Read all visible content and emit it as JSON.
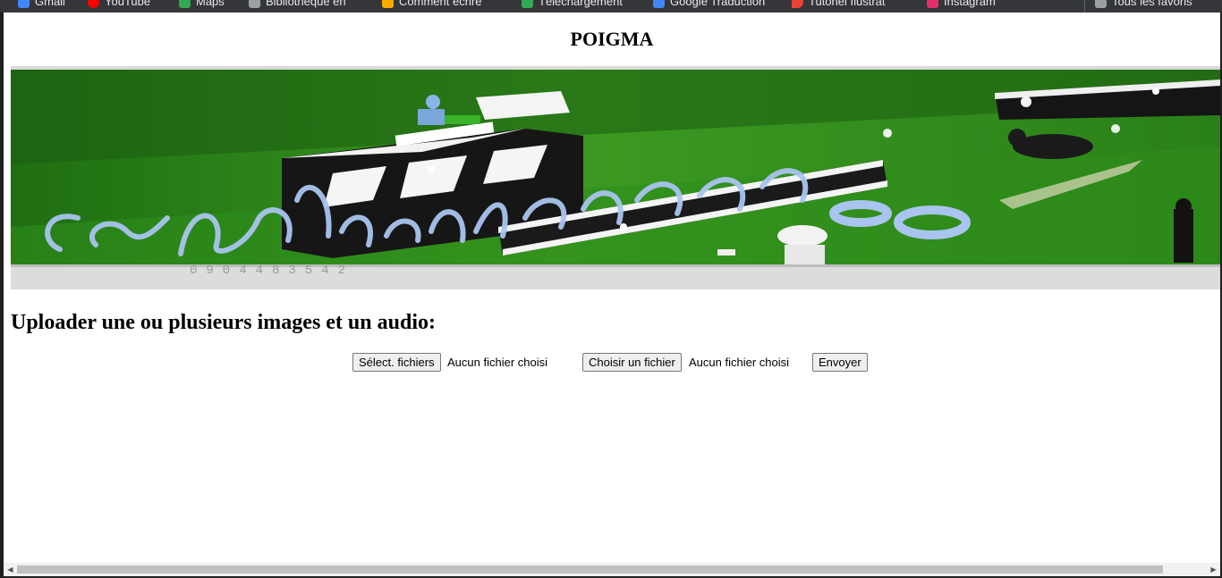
{
  "page": {
    "title": "POIGMA",
    "upload_heading": "Uploader une ou plusieurs images et un audio:"
  },
  "bookmarks": [
    {
      "label": "Gmail",
      "icon": "gmail-icon",
      "color": "#4285f4"
    },
    {
      "label": "YouTube",
      "icon": "youtube-icon",
      "color": "#ff0000"
    },
    {
      "label": "Maps",
      "icon": "maps-icon",
      "color": "#34a853"
    },
    {
      "label": "Bibliothèque en",
      "icon": "library-icon",
      "color": "#9aa0a6"
    },
    {
      "label": "Comment écrire",
      "icon": "folder-icon",
      "color": "#f9ab00"
    },
    {
      "label": "Téléchargement",
      "icon": "download-icon",
      "color": "#34a853"
    },
    {
      "label": "Google Traduction",
      "icon": "translate-icon",
      "color": "#4285f4"
    },
    {
      "label": "Tutoriel Ilustrat",
      "icon": "pin-icon",
      "color": "#ea4335"
    },
    {
      "label": "Instagram",
      "icon": "instagram-icon",
      "color": "#e1306c"
    }
  ],
  "bookmarks_all": {
    "label": "Tous les favoris",
    "icon": "folder-icon"
  },
  "banner": {
    "signature_text": "Ceskarkhys'08",
    "icon": "film-clapperboard-banner"
  },
  "form": {
    "images_button": "Sélect. fichiers",
    "images_status": "Aucun fichier choisi",
    "audio_button": "Choisir un fichier",
    "audio_status": "Aucun fichier choisi",
    "submit_button": "Envoyer"
  },
  "colors": {
    "bookmarks_bg": "#35363a",
    "banner_green": "#2d7f1a",
    "button_bg": "#efefef"
  }
}
